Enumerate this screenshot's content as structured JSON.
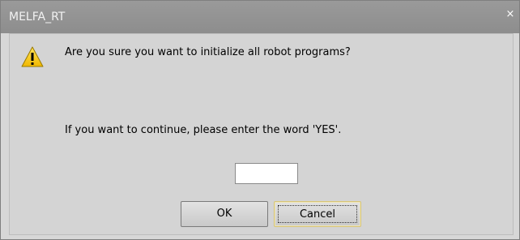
{
  "window": {
    "title": "MELFA_RT",
    "close_glyph": "×"
  },
  "dialog": {
    "icon": "warning-icon",
    "message": "Are you sure you want to initialize all robot programs?",
    "instruction": "If you want to continue, please enter the word 'YES'.",
    "input_value": "",
    "input_placeholder": ""
  },
  "buttons": {
    "ok_label": "OK",
    "cancel_label": "Cancel"
  },
  "colors": {
    "titlebar": "#8d8d8d",
    "dialog_bg": "#d4d4d4",
    "warning_yellow": "#f5c400",
    "cancel_focus_border": "#d6c478"
  }
}
